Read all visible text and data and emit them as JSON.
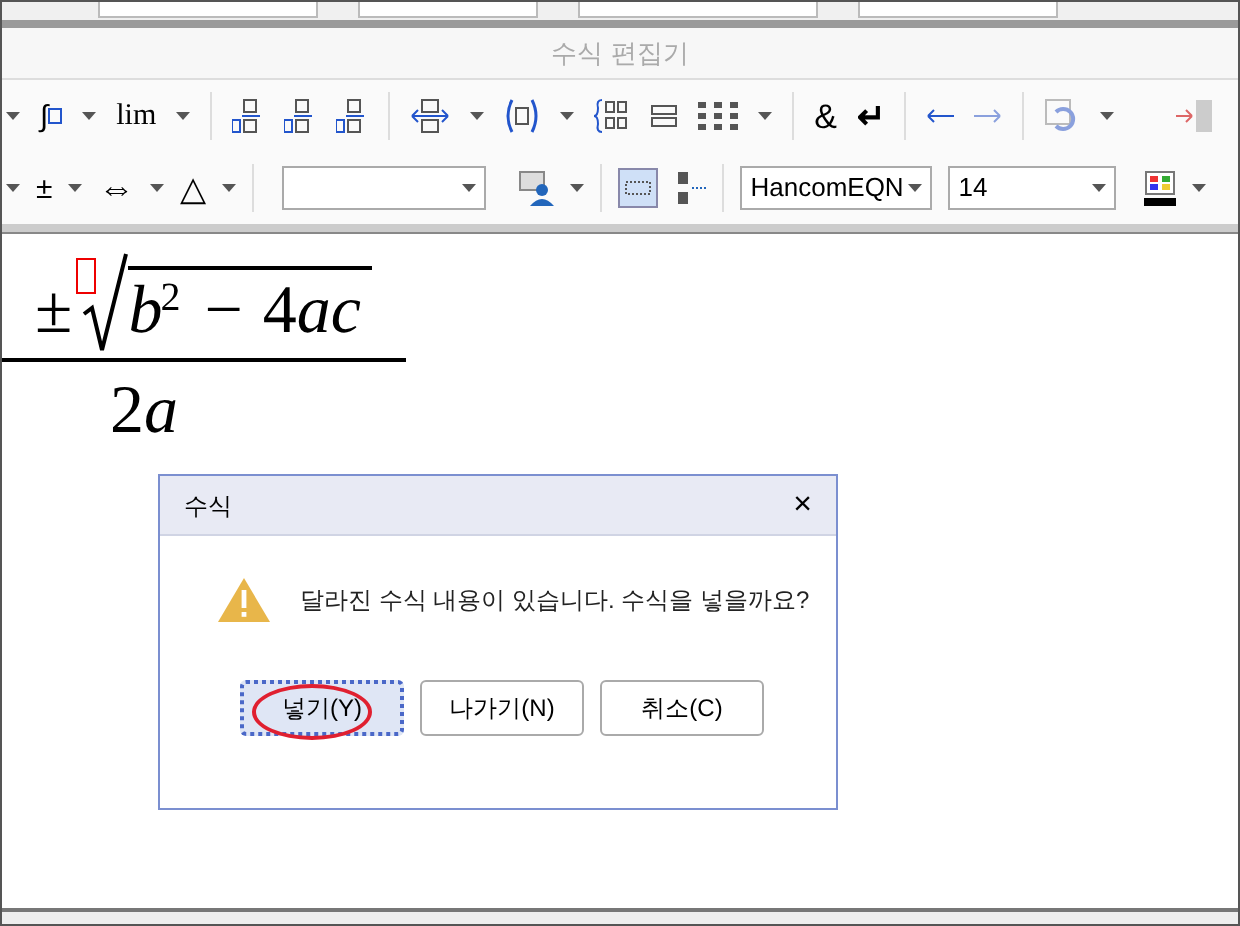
{
  "editor_title": "수식 편집기",
  "toolbar": {
    "integral": "∫",
    "limit": "lim",
    "ampersand": "&",
    "enter": "↵",
    "plus_minus": "±",
    "double_arrow": "⇔",
    "triangle": "△",
    "font_name": "HancomEQN",
    "font_size": "14"
  },
  "formula": {
    "sign": "±",
    "radicand": [
      {
        "text": "b",
        "kind": "var"
      },
      {
        "text": "2",
        "kind": "sup"
      },
      {
        "text": "−",
        "kind": "op"
      },
      {
        "text": "4",
        "kind": "num"
      },
      {
        "text": "ac",
        "kind": "var"
      }
    ],
    "denominator": [
      {
        "text": "2",
        "kind": "num"
      },
      {
        "text": "a",
        "kind": "var"
      }
    ],
    "empty_slot": true
  },
  "dialog": {
    "title": "수식",
    "close": "×",
    "message": "달라진 수식 내용이 있습니다. 수식을 넣을까요?",
    "buttons": [
      {
        "label": "넣기(Y)",
        "focused": true,
        "circled": true
      },
      {
        "label": "나가기(N)",
        "focused": false,
        "circled": false
      },
      {
        "label": "취소(C)",
        "focused": false,
        "circled": false
      }
    ]
  }
}
